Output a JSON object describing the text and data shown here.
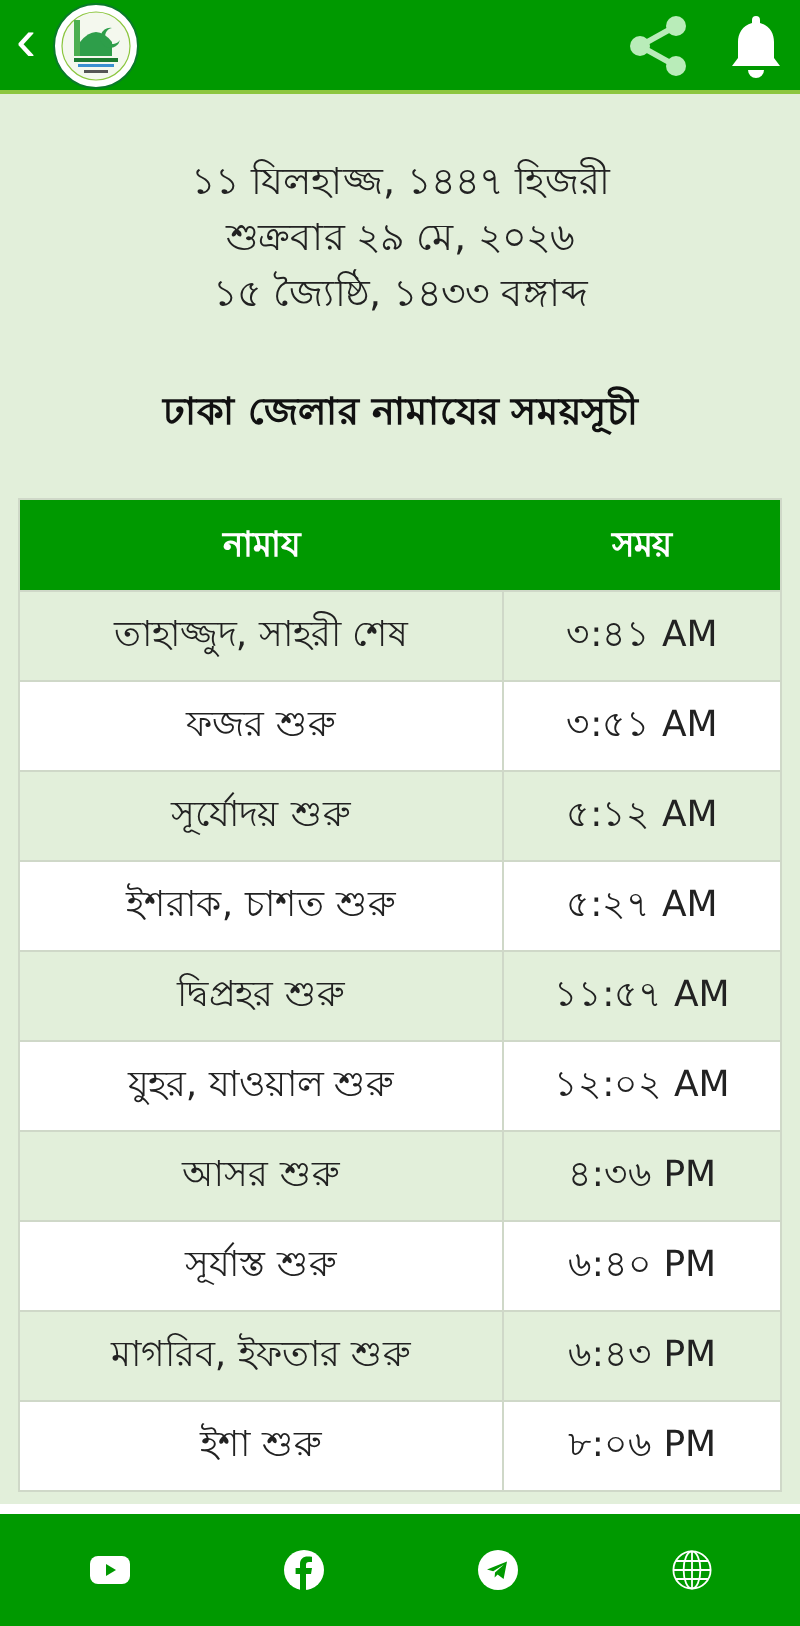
{
  "header": {
    "back": "‹"
  },
  "dates": [
    "১১ যিলহাজ্জ, ১৪৪৭ হিজরী",
    "শুক্রবার ২৯ মে, ২০২৬",
    "১৫ জ্যৈষ্ঠি, ১৪৩৩ বঙ্গাব্দ"
  ],
  "title": "ঢাকা জেলার নামাযের সময়সূচী",
  "table": {
    "columns": [
      "নামায",
      "সময়"
    ],
    "rows": [
      {
        "name": "তাহাজ্জুদ, সাহরী শেষ",
        "time": "৩:৪১ AM"
      },
      {
        "name": "ফজর শুরু",
        "time": "৩:৫১ AM"
      },
      {
        "name": "সূর্যোদয় শুরু",
        "time": "৫:১২ AM"
      },
      {
        "name": "ইশরাক, চাশত শুরু",
        "time": "৫:২৭ AM"
      },
      {
        "name": "দ্বিপ্রহর শুরু",
        "time": "১১:৫৭ AM"
      },
      {
        "name": "যুহর, যাওয়াল শুরু",
        "time": "১২:০২ AM"
      },
      {
        "name": "আসর শুরু",
        "time": "৪:৩৬ PM"
      },
      {
        "name": "সূর্যাস্ত শুরু",
        "time": "৬:৪০ PM"
      },
      {
        "name": "মাগরিব, ইফতার শুরু",
        "time": "৬:৪৩ PM"
      },
      {
        "name": "ইশা শুরু",
        "time": "৮:০৬ PM"
      }
    ]
  },
  "footer": [
    {
      "kind": "youtube"
    },
    {
      "kind": "facebook"
    },
    {
      "kind": "telegram"
    },
    {
      "kind": "web"
    }
  ]
}
